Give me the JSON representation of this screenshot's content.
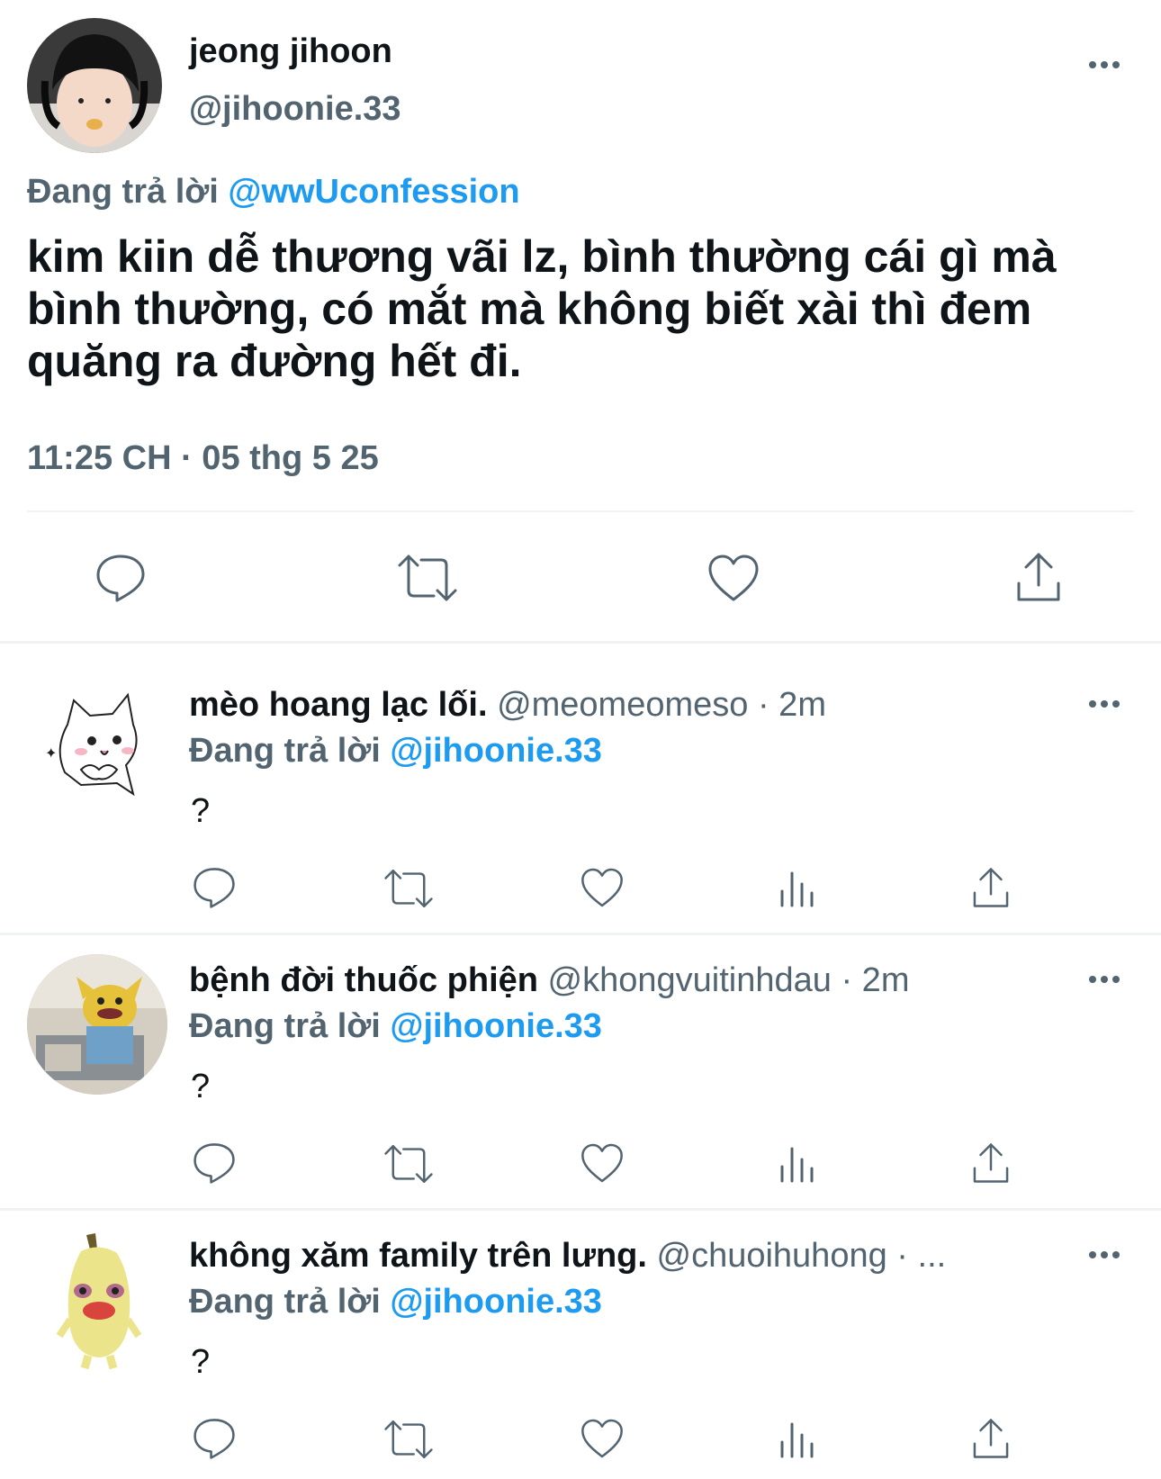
{
  "main_tweet": {
    "display_name": "jeong jihoon",
    "handle": "@jihoonie.33",
    "reply_prefix": "Đang trả lời",
    "reply_to": "@wwUconfession",
    "text": "kim kiin dễ thương vãi lz, bình thường cái gì mà bình thường, có mắt mà không biết xài thì đem quăng ra đường hết đi.",
    "timestamp": "11:25 CH · 05 thg 5 25"
  },
  "replies": [
    {
      "display_name": "mèo hoang lạc lối.",
      "handle": "@meomeomeso",
      "time": "· 2m",
      "reply_prefix": "Đang trả lời",
      "reply_to": "@jihoonie.33",
      "text": "?"
    },
    {
      "display_name": "bệnh đời thuốc phiện",
      "handle": "@khongvuitinhdau",
      "time": "· 2m",
      "reply_prefix": "Đang trả lời",
      "reply_to": "@jihoonie.33",
      "text": "?"
    },
    {
      "display_name": "không xăm family trên lưng.",
      "handle": "@chuoihuhong",
      "time": "· ...",
      "reply_prefix": "Đang trả lời",
      "reply_to": "@jihoonie.33",
      "text": "?"
    }
  ],
  "icons": {
    "reply": "reply-icon",
    "retweet": "retweet-icon",
    "like": "heart-icon",
    "views": "views-icon",
    "share": "share-icon",
    "more": "more-icon"
  },
  "colors": {
    "text": "#0f1419",
    "secondary": "#536471",
    "link": "#1d9bf0",
    "divider": "#eff3f4"
  }
}
